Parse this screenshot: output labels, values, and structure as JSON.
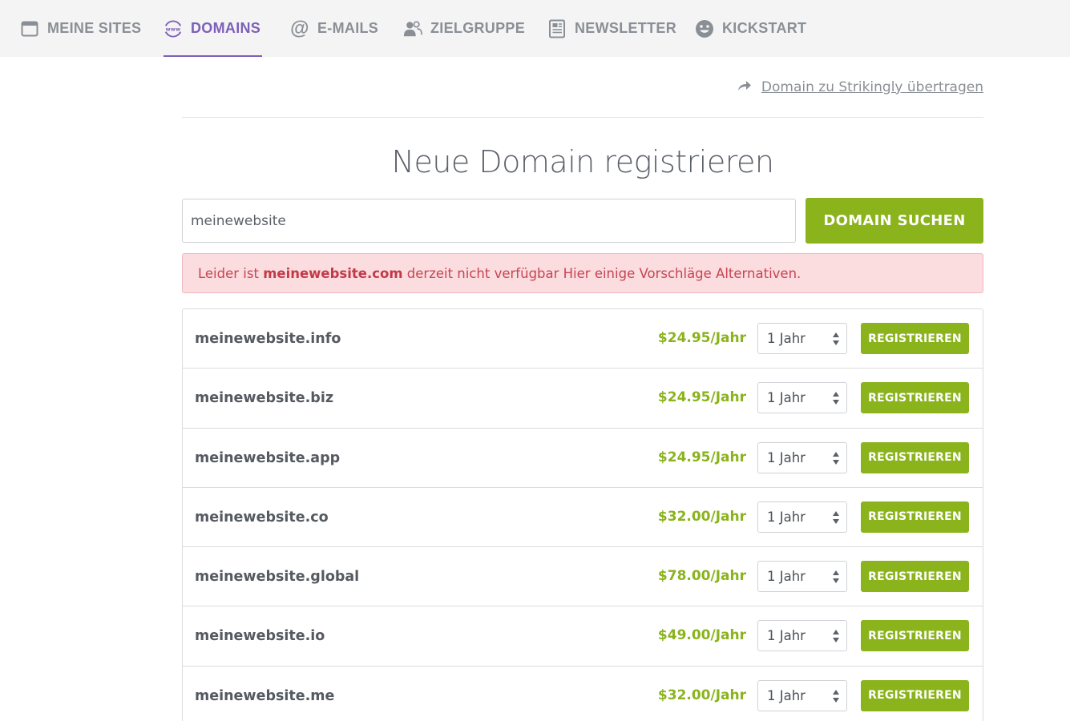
{
  "nav": {
    "items": [
      {
        "label": "MEINE SITES",
        "icon": "browser-window-icon"
      },
      {
        "label": "DOMAINS",
        "icon": "www-globe-icon",
        "active": true
      },
      {
        "label": "E-MAILS",
        "icon": "at-sign-icon"
      },
      {
        "label": "ZIELGRUPPE",
        "icon": "users-icon"
      },
      {
        "label": "NEWSLETTER",
        "icon": "newsletter-icon"
      },
      {
        "label": "KICKSTART",
        "icon": "smiley-icon"
      }
    ]
  },
  "transfer": {
    "label": "Domain zu Strikingly übertragen",
    "icon": "arrow-right-icon"
  },
  "page_title": "Neue Domain registrieren",
  "search": {
    "value": "meinewebsite",
    "button_label": "DOMAIN SUCHEN"
  },
  "alert": {
    "prefix": "Leider ist ",
    "domain": "meinewebsite.com",
    "suffix": " derzeit nicht verfügbar Hier einige Vorschläge Alternativen."
  },
  "colors": {
    "accent_green": "#8ab31c",
    "nav_active": "#7d5fb8",
    "alert_bg": "#fbdcdf",
    "alert_text": "#c64552"
  },
  "results": [
    {
      "domain": "meinewebsite.info",
      "price": "$24.95/Jahr",
      "term": "1 Jahr",
      "button": "REGISTRIEREN"
    },
    {
      "domain": "meinewebsite.biz",
      "price": "$24.95/Jahr",
      "term": "1 Jahr",
      "button": "REGISTRIEREN"
    },
    {
      "domain": "meinewebsite.app",
      "price": "$24.95/Jahr",
      "term": "1 Jahr",
      "button": "REGISTRIEREN"
    },
    {
      "domain": "meinewebsite.co",
      "price": "$32.00/Jahr",
      "term": "1 Jahr",
      "button": "REGISTRIEREN"
    },
    {
      "domain": "meinewebsite.global",
      "price": "$78.00/Jahr",
      "term": "1 Jahr",
      "button": "REGISTRIEREN"
    },
    {
      "domain": "meinewebsite.io",
      "price": "$49.00/Jahr",
      "term": "1 Jahr",
      "button": "REGISTRIEREN"
    },
    {
      "domain": "meinewebsite.me",
      "price": "$32.00/Jahr",
      "term": "1 Jahr",
      "button": "REGISTRIEREN"
    }
  ]
}
